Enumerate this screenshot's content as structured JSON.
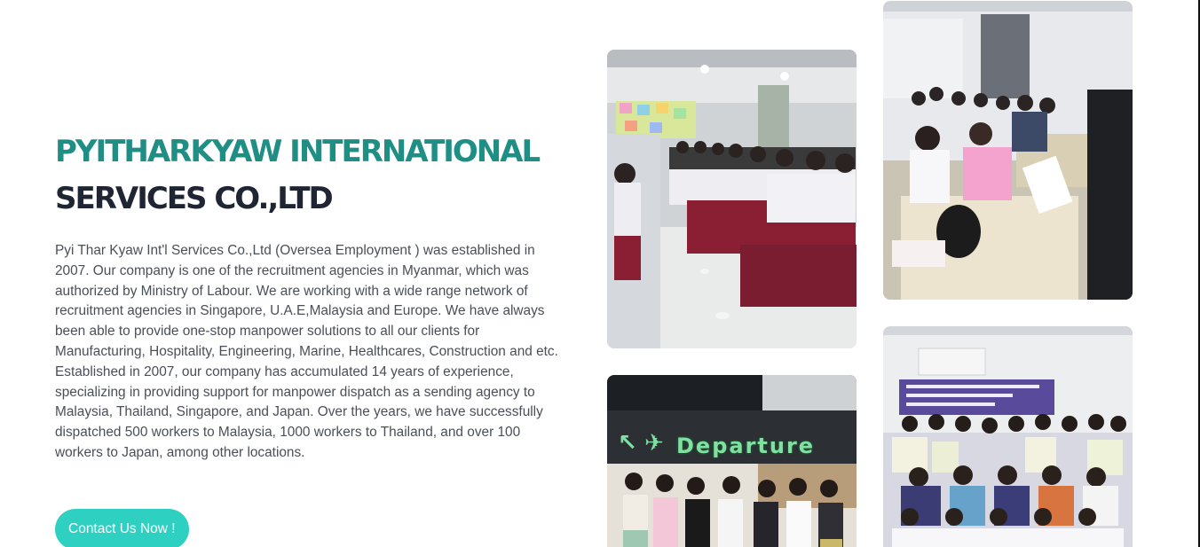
{
  "hero": {
    "title_line1": "PYITHARKYAW INTERNATIONAL",
    "title_line2": "SERVICES CO.,LTD",
    "paragraph1": "Pyi Thar Kyaw Int'l Services Co.,Ltd (Oversea Employment ) was established in 2007. Our company is one of the recruitment agencies in Myanmar, which was authorized by Ministry of Labour. We are working with a wide range network of recruitment agencies in Singapore, U.A.E,Malaysia and Europe. We have always been able to provide one-stop manpower solutions to all our clients for Manufacturing, Hospitality, Engineering, Marine, Healthcares, Construction and etc.",
    "paragraph2": "Established in 2007, our company has accumulated 14 years of experience, specializing in providing support for manpower dispatch as a sending agency to Malaysia, Thailand, Singapore, and Japan. Over the years, we have successfully dispatched 500 workers to Malaysia, 1000 workers to Thailand, and over 100 workers to Japan, among other locations.",
    "cta_label": "Contact Us Now !"
  },
  "gallery": {
    "departure_sign": "Departure"
  },
  "colors": {
    "title_accent": "#1f8f86",
    "title_dark": "#1f2533",
    "cta_bg": "#2ed0c2"
  }
}
